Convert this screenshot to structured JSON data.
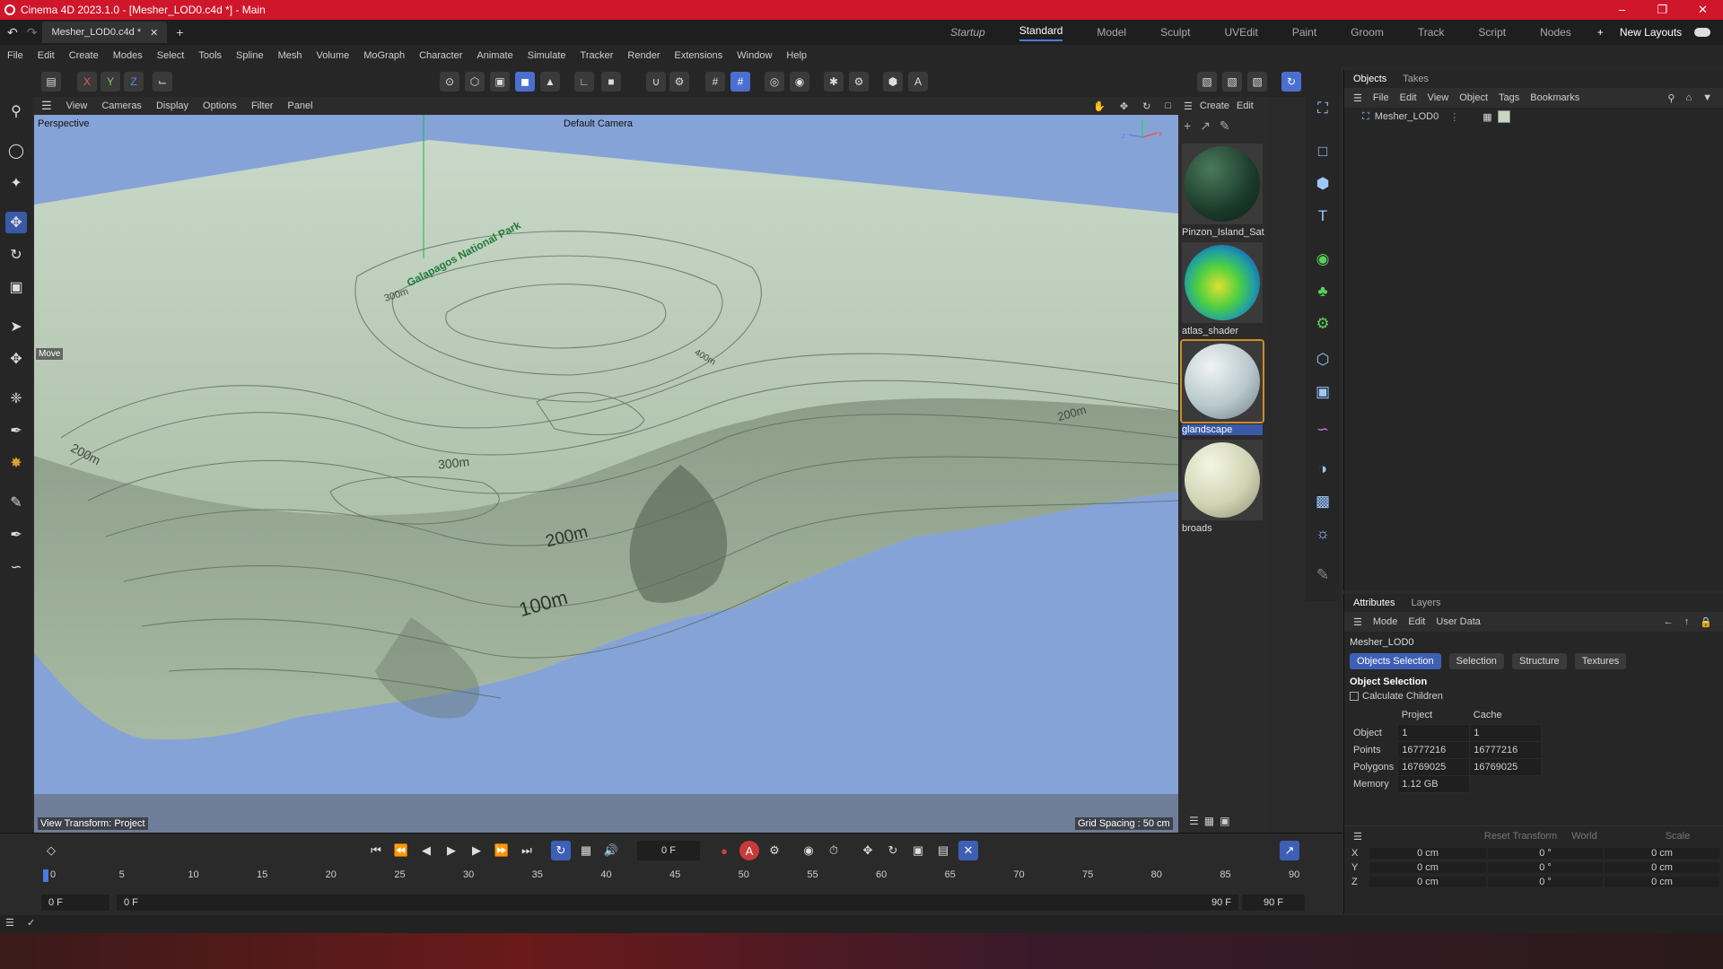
{
  "titlebar": {
    "title": "Cinema 4D 2023.1.0 - [Mesher_LOD0.c4d *] - Main"
  },
  "doc_tab": {
    "name": "Mesher_LOD0.c4d *"
  },
  "layouts": [
    "Startup",
    "Standard",
    "Model",
    "Sculpt",
    "UVEdit",
    "Paint",
    "Groom",
    "Track",
    "Script",
    "Nodes"
  ],
  "layouts_extra": {
    "new_layouts": "New Layouts"
  },
  "menu": [
    "File",
    "Edit",
    "Create",
    "Modes",
    "Select",
    "Tools",
    "Spline",
    "Mesh",
    "Volume",
    "MoGraph",
    "Character",
    "Animate",
    "Simulate",
    "Tracker",
    "Render",
    "Extensions",
    "Window",
    "Help"
  ],
  "axis_buttons": [
    "X",
    "Y",
    "Z"
  ],
  "viewport": {
    "menu": [
      "View",
      "Cameras",
      "Display",
      "Options",
      "Filter",
      "Panel"
    ],
    "label": "Perspective",
    "camera": "Default Camera",
    "move_hint": "Move",
    "view_transform": "View Transform: Project",
    "grid_spacing": "Grid Spacing : 50 cm",
    "map_text": "Galapagos National Park",
    "contours": [
      "300m",
      "200m",
      "100m",
      "200m",
      "300m",
      "200m",
      "400m"
    ]
  },
  "materials": {
    "menu": [
      "Create",
      "Edit"
    ],
    "items": [
      {
        "name": "Pinzon_Island_Sat"
      },
      {
        "name": "atlas_shader"
      },
      {
        "name": "glandscape"
      },
      {
        "name": "broads"
      }
    ]
  },
  "objects": {
    "tabs": [
      "Objects",
      "Takes"
    ],
    "menu": [
      "File",
      "Edit",
      "View",
      "Object",
      "Tags",
      "Bookmarks"
    ],
    "items": [
      {
        "name": "Mesher_LOD0"
      }
    ]
  },
  "attributes": {
    "tabs": [
      "Attributes",
      "Layers"
    ],
    "menu": [
      "Mode",
      "Edit",
      "User Data"
    ],
    "object_name": "Mesher_LOD0",
    "subtabs": [
      "Objects Selection",
      "Selection",
      "Structure",
      "Textures"
    ],
    "section": "Object Selection",
    "calc_children": "Calculate Children",
    "col_project": "Project",
    "col_cache": "Cache",
    "rows": [
      {
        "label": "Object",
        "project": "1",
        "cache": "1"
      },
      {
        "label": "Points",
        "project": "16777216",
        "cache": "16777216"
      },
      {
        "label": "Polygons",
        "project": "16769025",
        "cache": "16769025"
      },
      {
        "label": "Memory",
        "project": "1.12 GB",
        "cache": ""
      }
    ],
    "transform": {
      "reset": "Reset Transform",
      "space": "World",
      "scale": "Scale",
      "rows": [
        {
          "axis": "X",
          "a": "0 cm",
          "b": "0 °",
          "c": "0 cm"
        },
        {
          "axis": "Y",
          "a": "0 cm",
          "b": "0 °",
          "c": "0 cm"
        },
        {
          "axis": "Z",
          "a": "0 cm",
          "b": "0 °",
          "c": "0 cm"
        }
      ]
    }
  },
  "timeline": {
    "current_frame": "0 F",
    "ticks": [
      "0",
      "5",
      "10",
      "15",
      "20",
      "25",
      "30",
      "35",
      "40",
      "45",
      "50",
      "55",
      "60",
      "65",
      "70",
      "75",
      "80",
      "85",
      "90"
    ],
    "start": "0 F",
    "preview_start": "0 F",
    "preview_end": "90 F",
    "end": "90 F"
  }
}
